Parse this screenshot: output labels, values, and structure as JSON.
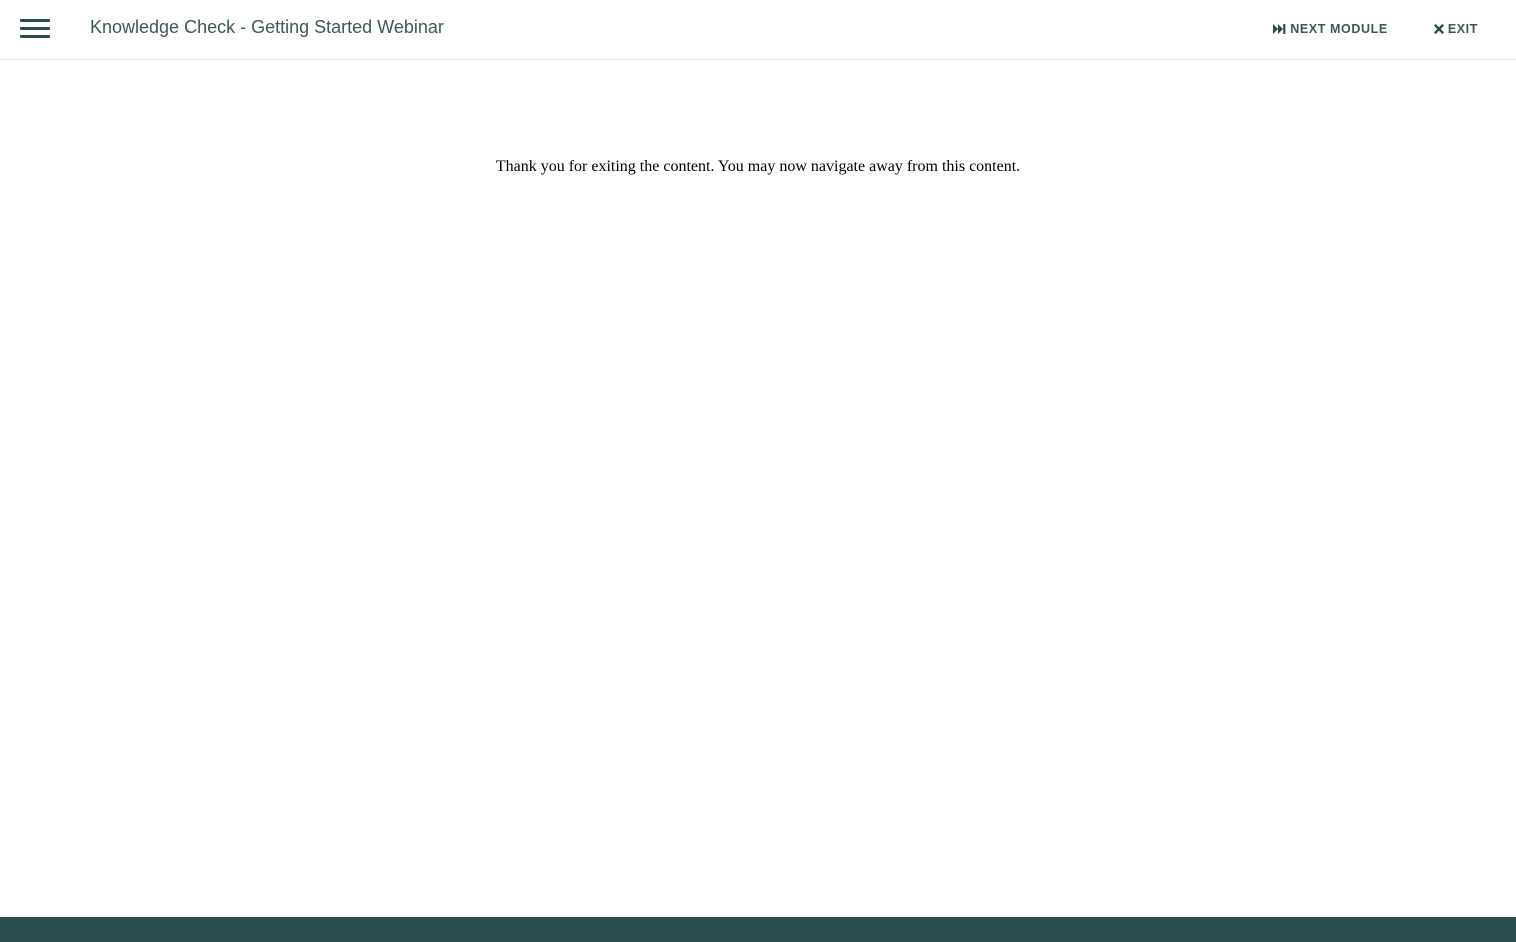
{
  "header": {
    "menu_icon": "hamburger-menu-icon",
    "title": "Knowledge Check - Getting Started Webinar",
    "next_module": {
      "label": "NEXT MODULE",
      "icon": "skip-forward-icon"
    },
    "exit": {
      "label": "EXIT",
      "icon": "close-icon"
    }
  },
  "main": {
    "message": "Thank you for exiting the content. You may now navigate away from this content."
  },
  "colors": {
    "brand": "#2c4d4f",
    "header_text": "#3f5659",
    "background": "#ffffff"
  }
}
